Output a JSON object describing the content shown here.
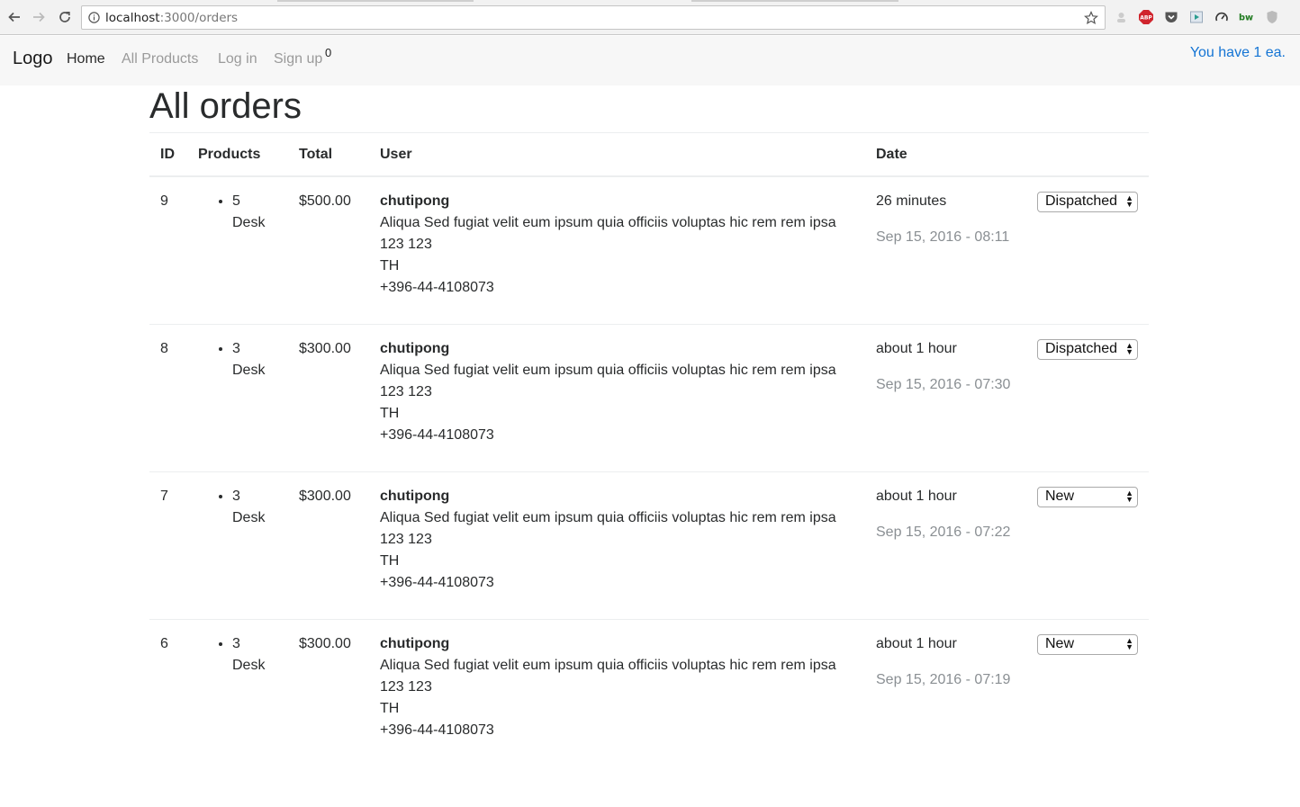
{
  "browser": {
    "url_host": "localhost",
    "url_path": ":3000/orders"
  },
  "navbar": {
    "brand": "Logo",
    "links": [
      "Home",
      "All Products",
      "Log in",
      "Sign up"
    ],
    "cart_badge": "0",
    "cart_text": "You have 1 ea."
  },
  "page": {
    "title": "All orders"
  },
  "table": {
    "headers": [
      "ID",
      "Products",
      "Total",
      "User",
      "Date",
      ""
    ],
    "rows": [
      {
        "id": "9",
        "product_qty": "5",
        "product_name": "Desk",
        "total": "$500.00",
        "user_name": "chutipong",
        "address": "Aliqua Sed fugiat velit eum ipsum quia officiis voluptas hic rem rem ipsa",
        "postcode": "123 123",
        "country": "TH",
        "phone": "+396-44-4108073",
        "date_relative": "26 minutes",
        "date_absolute": "Sep 15, 2016 - 08:11",
        "status": "Dispatched"
      },
      {
        "id": "8",
        "product_qty": "3",
        "product_name": "Desk",
        "total": "$300.00",
        "user_name": "chutipong",
        "address": "Aliqua Sed fugiat velit eum ipsum quia officiis voluptas hic rem rem ipsa",
        "postcode": "123 123",
        "country": "TH",
        "phone": "+396-44-4108073",
        "date_relative": "about 1 hour",
        "date_absolute": "Sep 15, 2016 - 07:30",
        "status": "Dispatched"
      },
      {
        "id": "7",
        "product_qty": "3",
        "product_name": "Desk",
        "total": "$300.00",
        "user_name": "chutipong",
        "address": "Aliqua Sed fugiat velit eum ipsum quia officiis voluptas hic rem rem ipsa",
        "postcode": "123 123",
        "country": "TH",
        "phone": "+396-44-4108073",
        "date_relative": "about 1 hour",
        "date_absolute": "Sep 15, 2016 - 07:22",
        "status": "New"
      },
      {
        "id": "6",
        "product_qty": "3",
        "product_name": "Desk",
        "total": "$300.00",
        "user_name": "chutipong",
        "address": "Aliqua Sed fugiat velit eum ipsum quia officiis voluptas hic rem rem ipsa",
        "postcode": "123 123",
        "country": "TH",
        "phone": "+396-44-4108073",
        "date_relative": "about 1 hour",
        "date_absolute": "Sep 15, 2016 - 07:19",
        "status": "New"
      }
    ]
  },
  "colors": {
    "link_accent": "#1474d4",
    "navbar_bg": "#f7f7f7",
    "muted_text": "#8a8f93"
  },
  "icons": [
    "back-arrow-icon",
    "forward-arrow-icon",
    "reload-icon",
    "info-icon",
    "bookmark-star-icon",
    "adblock-icon",
    "pocket-icon",
    "cast-icon",
    "speed-icon",
    "extension-bw-icon",
    "shield-icon"
  ]
}
